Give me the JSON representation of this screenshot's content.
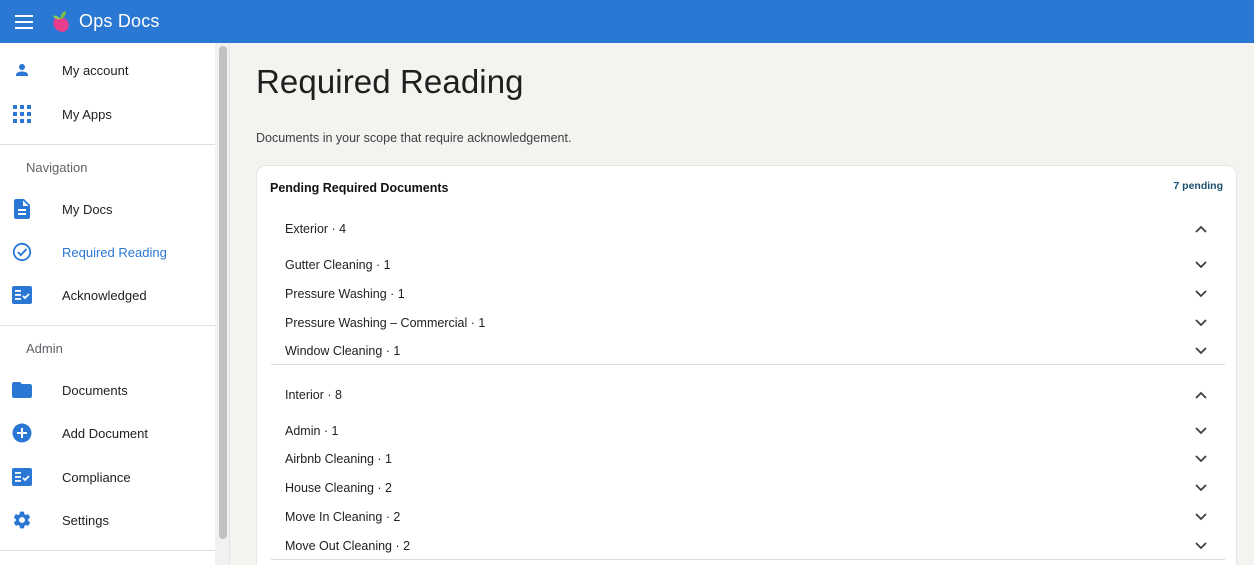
{
  "header": {
    "app_title": "Ops Docs",
    "brand_color": "#2a78d3"
  },
  "sidebar": {
    "account_items": [
      {
        "label": "My account",
        "icon": "person-icon"
      },
      {
        "label": "My Apps",
        "icon": "apps-grid-icon"
      }
    ],
    "navigation_header": "Navigation",
    "navigation_items": [
      {
        "label": "My Docs",
        "icon": "document-icon"
      },
      {
        "label": "Required Reading",
        "icon": "check-circle-icon",
        "active": true
      },
      {
        "label": "Acknowledged",
        "icon": "checklist-icon"
      }
    ],
    "admin_header": "Admin",
    "admin_items": [
      {
        "label": "Documents",
        "icon": "folder-icon"
      },
      {
        "label": "Add Document",
        "icon": "add-circle-icon"
      },
      {
        "label": "Compliance",
        "icon": "checklist-icon"
      },
      {
        "label": "Settings",
        "icon": "gear-icon"
      }
    ]
  },
  "main": {
    "title": "Required Reading",
    "subtitle": "Documents in your scope that require acknowledgement.",
    "card": {
      "title": "Pending Required Documents",
      "pending_count": "7 pending",
      "groups": [
        {
          "label": "Exterior · 4",
          "expanded": true,
          "items": [
            "Gutter Cleaning · 1",
            "Pressure Washing · 1",
            "Pressure Washing – Commercial · 1",
            "Window Cleaning · 1"
          ]
        },
        {
          "label": "Interior · 8",
          "expanded": true,
          "items": [
            "Admin · 1",
            "Airbnb Cleaning · 1",
            "House Cleaning · 2",
            "Move In Cleaning · 2",
            "Move Out Cleaning · 2"
          ]
        }
      ]
    }
  }
}
